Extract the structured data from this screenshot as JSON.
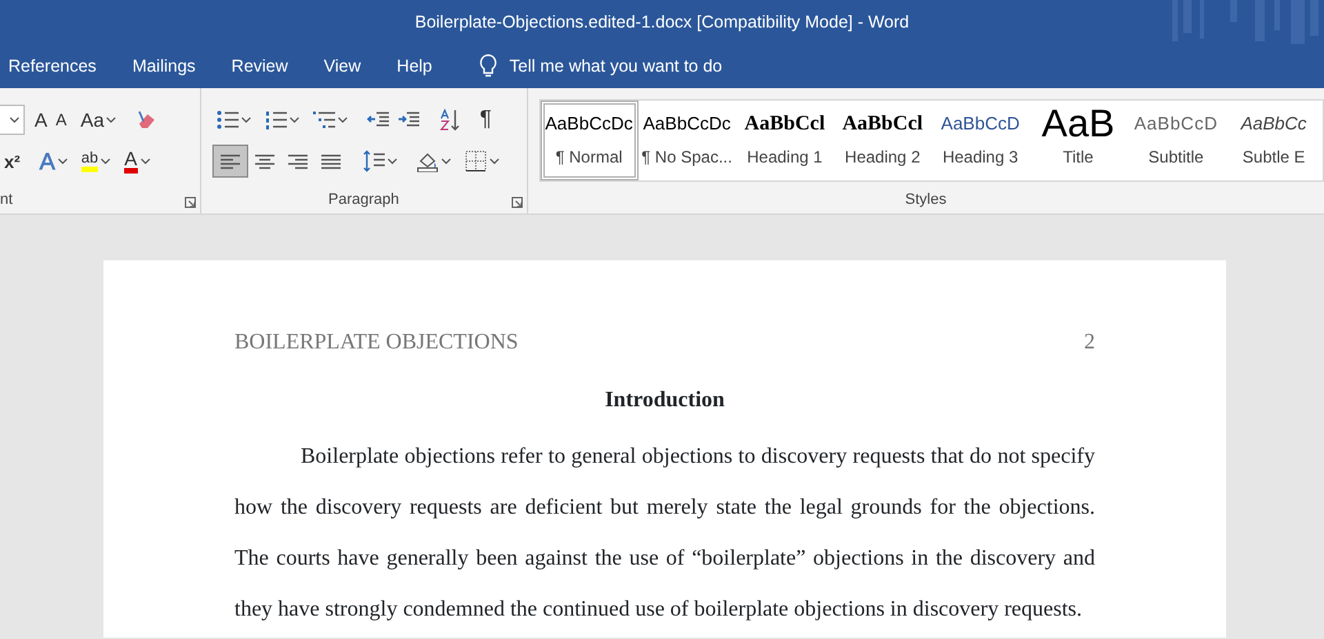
{
  "window": {
    "title": "Boilerplate-Objections.edited-1.docx [Compatibility Mode]  -  Word"
  },
  "tabs": [
    {
      "label": "References"
    },
    {
      "label": "Mailings"
    },
    {
      "label": "Review"
    },
    {
      "label": "View"
    },
    {
      "label": "Help"
    }
  ],
  "tell_me": {
    "placeholder": "Tell me what you want to do"
  },
  "font_group": {
    "label": "nt",
    "grow_font": "A",
    "shrink_font": "A",
    "change_case": "Aa",
    "superscript": "x²",
    "text_effects": "A",
    "highlight": "ab",
    "font_color": "A"
  },
  "paragraph_group": {
    "label": "Paragraph",
    "show_marks": "¶",
    "alignment_buttons": [
      {
        "selected": true
      },
      {
        "selected": false
      },
      {
        "selected": false
      },
      {
        "selected": false
      }
    ]
  },
  "styles_group": {
    "label": "Styles",
    "items": [
      {
        "preview": "AaBbCcDc",
        "name": "¶ Normal",
        "kind": "normal",
        "selected": true
      },
      {
        "preview": "AaBbCcDc",
        "name": "¶ No Spac...",
        "kind": "normal",
        "selected": false
      },
      {
        "preview": "AaBbCcl",
        "name": "Heading 1",
        "kind": "heading-serif",
        "selected": false
      },
      {
        "preview": "AaBbCcl",
        "name": "Heading 2",
        "kind": "heading-serif",
        "selected": false
      },
      {
        "preview": "AaBbCcD",
        "name": "Heading 3",
        "kind": "heading-blue",
        "selected": false
      },
      {
        "preview": "AaB",
        "name": "Title",
        "kind": "title",
        "selected": false
      },
      {
        "preview": "AaBbCcD",
        "name": "Subtitle",
        "kind": "subtitle",
        "selected": false
      },
      {
        "preview": "AaBbCc",
        "name": "Subtle E",
        "kind": "subtle",
        "selected": false
      }
    ]
  },
  "document": {
    "header": "BOILERPLATE OBJECTIONS",
    "page_number": "2",
    "heading": "Introduction",
    "paragraph": "Boilerplate objections refer to general objections to discovery requests that do not specify how the discovery requests are deficient but merely state the legal grounds for the objections. The courts have generally been against the use of “boilerplate” objections in the discovery and they have strongly condemned the continued use of boilerplate objections in discovery requests."
  }
}
